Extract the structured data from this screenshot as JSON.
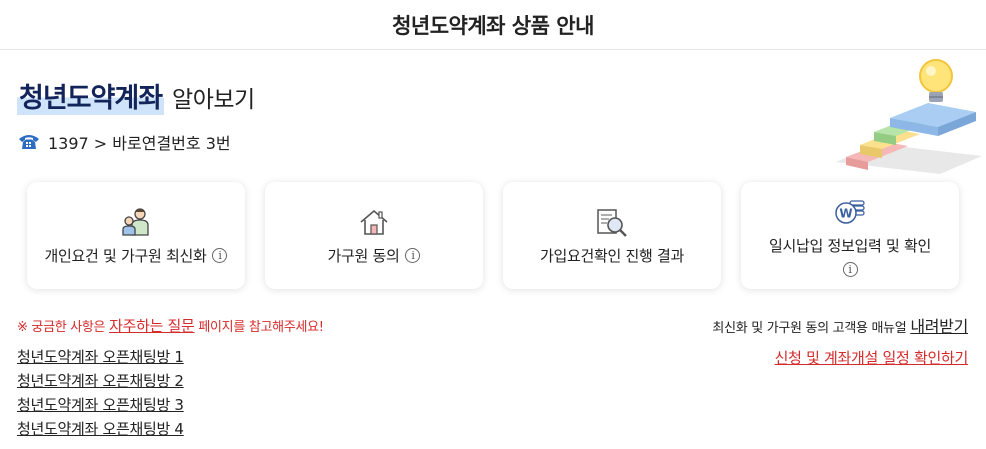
{
  "header": {
    "title": "청년도약계좌 상품 안내"
  },
  "intro": {
    "highlight": "청년도약계좌",
    "rest": "알아보기",
    "phone_text": "1397 > 바로연결번호 3번"
  },
  "cards": [
    {
      "label": "개인요건 및 가구원 최신화",
      "icon": "family-icon",
      "info": "i"
    },
    {
      "label": "가구원 동의",
      "icon": "house-icon",
      "info": "i"
    },
    {
      "label": "가입요건확인 진행 결과",
      "icon": "document-search-icon"
    },
    {
      "label": "일시납입 정보입력 및 확인",
      "icon": "won-coins-icon",
      "info": "i"
    }
  ],
  "notice": {
    "prefix": "※ 궁금한 사항은 ",
    "link": "자주하는 질문",
    "suffix": " 페이지를 참고해주세요!"
  },
  "manual": {
    "prefix": "최신화 및 가구원 동의 고객용 매뉴얼 ",
    "link": "내려받기"
  },
  "schedule_link": "신청 및 계좌개설 일정 확인하기",
  "chat_links": [
    "청년도약계좌 오픈채팅방 1",
    "청년도약계좌 오픈채팅방 2",
    "청년도약계좌 오픈채팅방 3",
    "청년도약계좌 오픈채팅방 4"
  ],
  "colors": {
    "accent_red": "#d62b2b",
    "navy": "#12245a",
    "highlight": "#cfe3fb"
  }
}
